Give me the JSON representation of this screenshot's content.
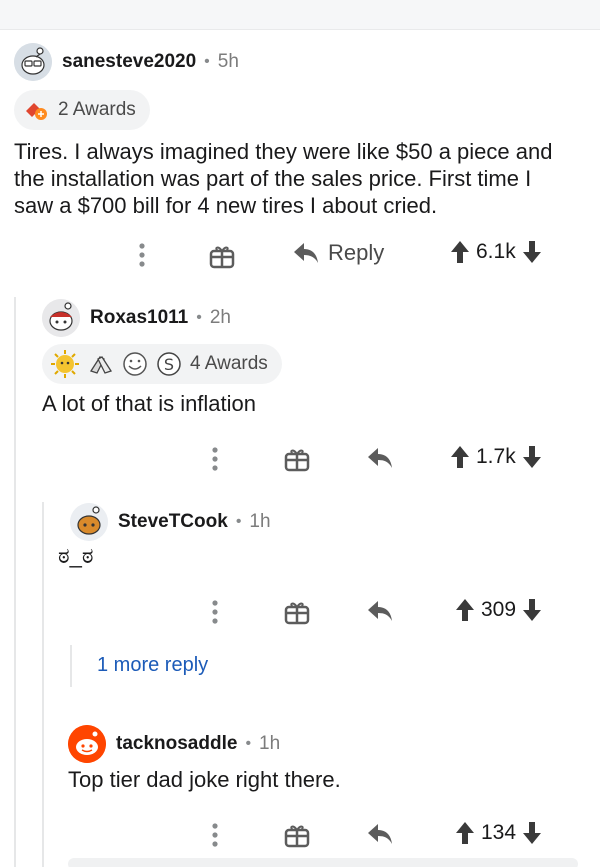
{
  "comments": [
    {
      "username": "sanesteve2020",
      "time": "5h",
      "awards_label": "2 Awards",
      "body": "Tires. I always imagined they were like $50 a piece and the installation was part of the sales price. First time I saw a $700 bill for 4 new tires I about cried.",
      "reply_label": "Reply",
      "score": "6.1k",
      "avatar_color": "#d7dee5"
    },
    {
      "username": "Roxas1011",
      "time": "2h",
      "awards_label": "4 Awards",
      "body": "A lot of that is inflation",
      "score": "1.7k",
      "avatar_color": "#e8e8ea"
    },
    {
      "username": "SteveTCook",
      "time": "1h",
      "body": "ಠ_ಠ",
      "score": "309",
      "avatar_color": "#ebeef2"
    },
    {
      "more_replies": "1 more reply"
    },
    {
      "username": "tacknosaddle",
      "time": "1h",
      "body": "Top tier dad joke right there.",
      "score": "134",
      "avatar_color": "#ff4500"
    }
  ],
  "icons": {
    "more": "more-options-icon",
    "gift": "gift-icon",
    "reply": "reply-arrow-icon",
    "upvote": "upvote-arrow-icon",
    "downvote": "downvote-arrow-icon"
  },
  "colors": {
    "text": "#1a1a1b",
    "muted": "#7c7c7c",
    "link": "#1c5bb8",
    "thread_line": "#e6e7e8",
    "award_pill": "#f2f3f4"
  }
}
